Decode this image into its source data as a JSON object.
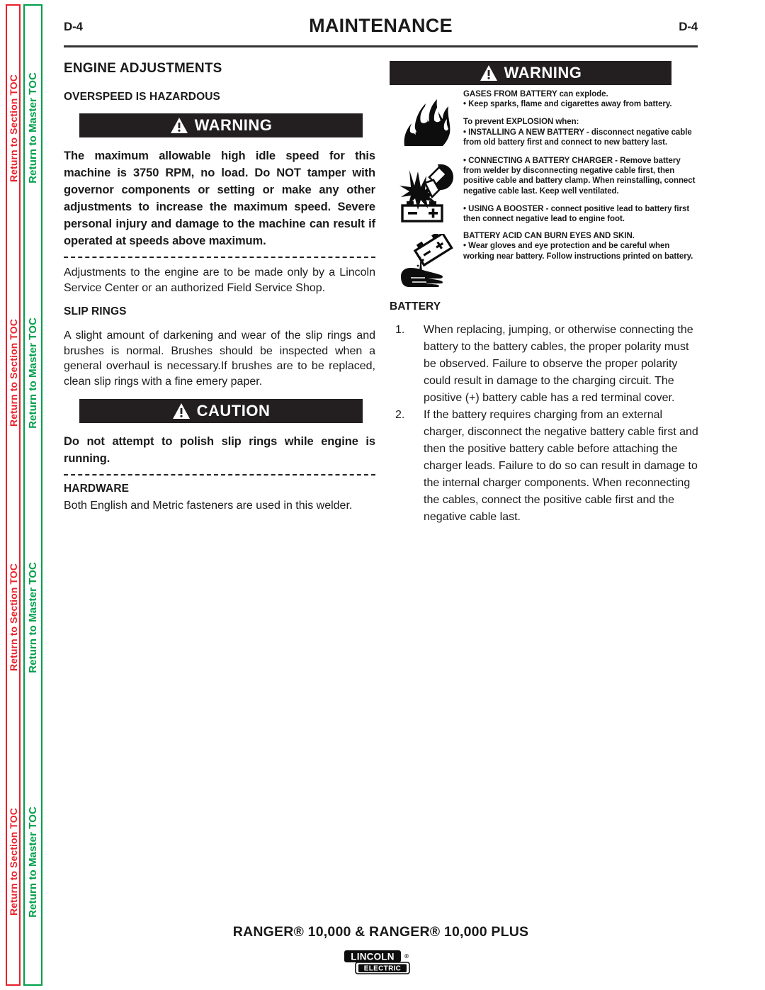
{
  "sidebar": {
    "section_toc_label": "Return to Section TOC",
    "master_toc_label": "Return to Master TOC",
    "section_toc_color": "#e8202a",
    "master_toc_color": "#00a04a",
    "repeat_count": 4
  },
  "header": {
    "page_number_left": "D-4",
    "title": "MAINTENANCE",
    "page_number_right": "D-4"
  },
  "left_column": {
    "section_heading": "ENGINE ADJUSTMENTS",
    "overspeed_heading": "OVERSPEED IS HAZARDOUS",
    "warning_banner": {
      "label": "WARNING",
      "icon": "warning-triangle-icon"
    },
    "warning_bold_text": "The maximum allowable high idle speed for this machine is 3750 RPM, no load.  Do NOT tamper with governor components or setting or make any other adjustments to increase the maximum speed.  Severe personal injury and damage to the machine can result if operated at speeds above maximum.",
    "warning_note_text": "Adjustments to the engine are to be made only by a Lincoln Service Center or an authorized Field Service Shop.",
    "slip_rings_heading": "SLIP RINGS",
    "slip_rings_text": "A slight amount of darkening and wear of the slip rings and brushes is normal. Brushes should be inspected when a general overhaul is necessary.If brushes are to be replaced, clean slip rings with a fine emery paper.",
    "caution_banner": {
      "label": "CAUTION",
      "icon": "warning-triangle-icon"
    },
    "caution_bold_text": "Do not attempt to polish slip rings while engine is running.",
    "hardware_heading": "HARDWARE",
    "hardware_text": "Both English and Metric fasteners are used in this welder."
  },
  "right_column": {
    "warning_banner": {
      "label": "WARNING",
      "icon": "warning-triangle-icon"
    },
    "warning_rows": [
      {
        "icon": "battery-explosion-flame-icon",
        "paragraphs": [
          "GASES FROM BATTERY can explode.\n•  Keep sparks, flame and cigarettes away from battery.",
          "To prevent EXPLOSION when:\n•  INSTALLING A NEW BATTERY -  disconnect negative cable from old battery first and connect to new battery last."
        ]
      },
      {
        "icon": "battery-spark-blast-icon",
        "paragraphs": [
          "•  CONNECTING A BATTERY CHARGER - Remove battery from welder by disconnecting negative cable first, then positive cable and battery clamp.  When reinstalling, connect negative cable last.  Keep well ventilated.",
          "•  USING A BOOSTER - connect positive lead to battery first then connect negative lead to engine foot."
        ]
      },
      {
        "icon": "battery-acid-hand-burn-icon",
        "paragraphs": [
          "BATTERY ACID CAN BURN EYES AND SKIN.\n•  Wear gloves and eye protection and be careful when working near battery.  Follow instructions printed on battery."
        ]
      }
    ],
    "battery_heading": "BATTERY",
    "battery_items": [
      {
        "number": "1.",
        "text": "When replacing, jumping, or otherwise connecting the battery to the battery cables, the proper polarity must be observed. Failure to observe the proper polarity could result in damage to the charging circuit. The positive (+) battery cable has a red terminal cover."
      },
      {
        "number": "2.",
        "text": "If the battery requires charging from an external charger, disconnect the negative battery cable first and then the positive battery cable before attaching the charger leads. Failure to do so can result in damage to the internal charger components. When reconnecting the cables, connect the positive cable first and the negative cable last."
      }
    ]
  },
  "footer": {
    "product_line_prefix": "RANGER",
    "product_title": "RANGER® 10,000 & RANGER® 10,000 PLUS",
    "logo_primary": "LINCOLN",
    "logo_secondary": "ELECTRIC",
    "logo_registered": "®"
  }
}
